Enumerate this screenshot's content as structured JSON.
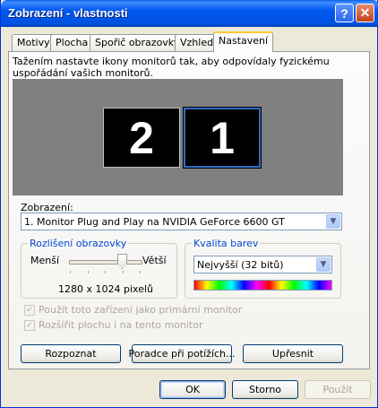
{
  "window": {
    "title": "Zobrazení - vlastnosti"
  },
  "titlebar": {
    "help_label": "?",
    "close_label": "✕"
  },
  "tabs": [
    {
      "label": "Motivy"
    },
    {
      "label": "Plocha"
    },
    {
      "label": "Spořič obrazovky"
    },
    {
      "label": "Vzhled"
    },
    {
      "label": "Nastavení",
      "active": true
    }
  ],
  "settings": {
    "description": "Tažením nastavte ikony monitorů tak, aby odpovídaly fyzickému uspořádání vašich monitorů.",
    "monitors": [
      {
        "label": "2",
        "selected": false
      },
      {
        "label": "1",
        "selected": true
      }
    ],
    "display_label": "Zobrazení:",
    "display_value": "1. Monitor Plug and Play na NVIDIA GeForce 6600 GT",
    "resolution": {
      "group_title": "Rozlišení obrazovky",
      "less_label": "Menší",
      "more_label": "Větší",
      "value_text": "1280 x 1024 pixelů",
      "slider_level": 0.85
    },
    "color": {
      "group_title": "Kvalita barev",
      "value": "Nejvyšší (32 bitů)"
    },
    "checkboxes": [
      {
        "label": "Použít toto zařízení jako primární monitor",
        "checked": true,
        "enabled": false
      },
      {
        "label": "Rozšířit plochu i na tento monitor",
        "checked": true,
        "enabled": false
      }
    ],
    "buttons": {
      "identify": "Rozpoznat",
      "troubleshoot": "Poradce při potížích...",
      "advanced": "Upřesnit"
    }
  },
  "footer": {
    "ok": "OK",
    "cancel": "Storno",
    "apply": "Použít"
  },
  "colors": {
    "title_bar": "#0058ee",
    "desktop_gray": "#808080",
    "selection": "#316ac5"
  },
  "icons": {
    "dropdown": "chevron-down-icon",
    "check": "checkmark-icon"
  }
}
